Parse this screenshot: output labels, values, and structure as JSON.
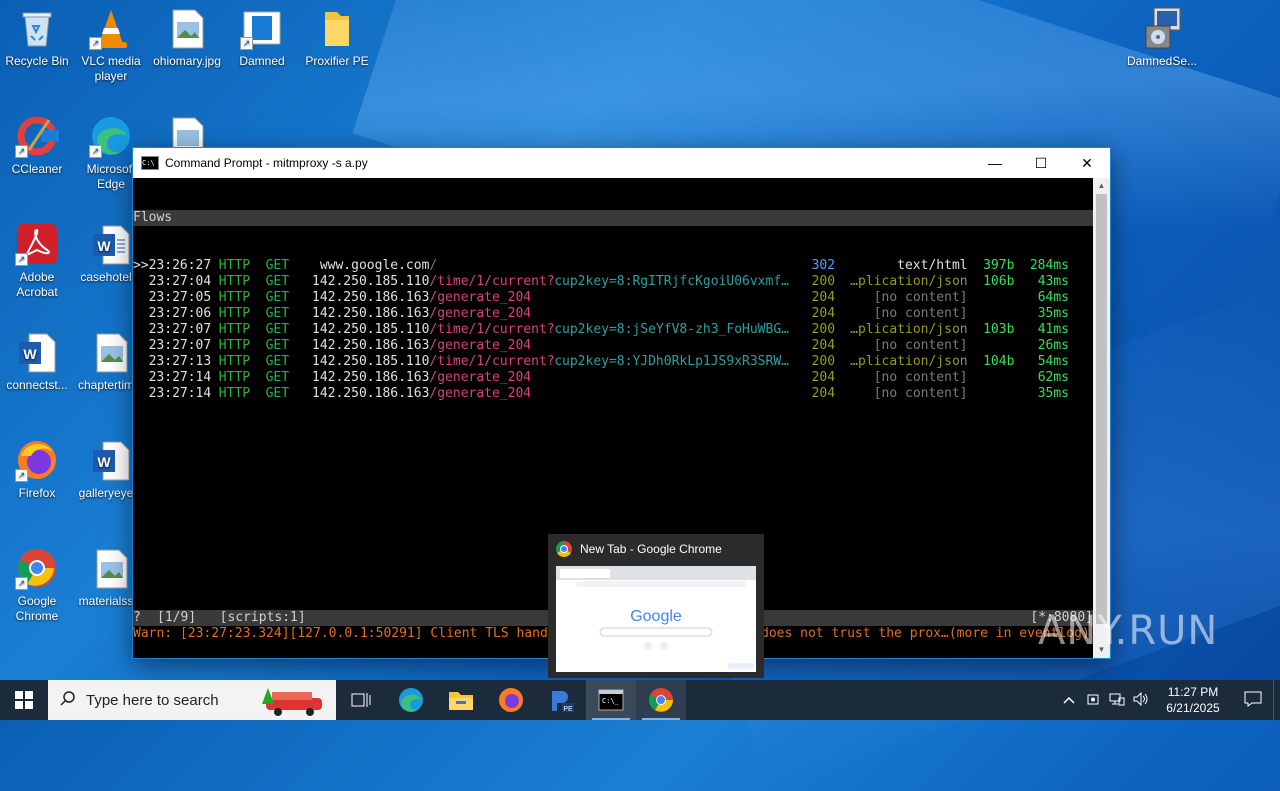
{
  "desktop": {
    "icons": [
      {
        "label": "Recycle Bin"
      },
      {
        "label": "VLC media player"
      },
      {
        "label": "ohiomary.jpg"
      },
      {
        "label": "Damned"
      },
      {
        "label": "Proxifier PE"
      },
      {
        "label": "DamnedSe..."
      },
      {
        "label": "CCleaner"
      },
      {
        "label": "Microsoft Edge"
      },
      {
        "label": "Adobe Acrobat"
      },
      {
        "label": "casehotel..."
      },
      {
        "label": "connectst..."
      },
      {
        "label": "chaptertim..."
      },
      {
        "label": "Firefox"
      },
      {
        "label": "galleryeye..."
      },
      {
        "label": "Google Chrome"
      },
      {
        "label": "materialss..."
      }
    ]
  },
  "window": {
    "title": "Command Prompt - mitmproxy  -s a.py",
    "header": "Flows",
    "flows": [
      {
        "marker": ">>",
        "time": "23:26:27",
        "proto": "HTTP",
        "method": "GET",
        "host": "www.google.com",
        "path": "/",
        "query": "",
        "code": "302",
        "type": "text/html",
        "size": "397b",
        "dur": "284ms"
      },
      {
        "marker": "",
        "time": "23:27:04",
        "proto": "HTTP",
        "method": "GET",
        "host": "142.250.185.110",
        "path": "/time/1/current?",
        "query": "cup2key=8:RgITRjfcKgoiU06vxmf…",
        "code": "200",
        "type": "…plication/json",
        "size": "106b",
        "dur": "43ms"
      },
      {
        "marker": "",
        "time": "23:27:05",
        "proto": "HTTP",
        "method": "GET",
        "host": "142.250.186.163",
        "path": "/generate_204",
        "query": "",
        "code": "204",
        "type": "[no content]",
        "size": "",
        "dur": "64ms"
      },
      {
        "marker": "",
        "time": "23:27:06",
        "proto": "HTTP",
        "method": "GET",
        "host": "142.250.186.163",
        "path": "/generate_204",
        "query": "",
        "code": "204",
        "type": "[no content]",
        "size": "",
        "dur": "35ms"
      },
      {
        "marker": "",
        "time": "23:27:07",
        "proto": "HTTP",
        "method": "GET",
        "host": "142.250.185.110",
        "path": "/time/1/current?",
        "query": "cup2key=8:jSeYfV8-zh3_FoHuWBG…",
        "code": "200",
        "type": "…plication/json",
        "size": "103b",
        "dur": "41ms"
      },
      {
        "marker": "",
        "time": "23:27:07",
        "proto": "HTTP",
        "method": "GET",
        "host": "142.250.186.163",
        "path": "/generate_204",
        "query": "",
        "code": "204",
        "type": "[no content]",
        "size": "",
        "dur": "26ms"
      },
      {
        "marker": "",
        "time": "23:27:13",
        "proto": "HTTP",
        "method": "GET",
        "host": "142.250.185.110",
        "path": "/time/1/current?",
        "query": "cup2key=8:YJDh0RkLp1JS9xR3SRW…",
        "code": "200",
        "type": "…plication/json",
        "size": "104b",
        "dur": "54ms"
      },
      {
        "marker": "",
        "time": "23:27:14",
        "proto": "HTTP",
        "method": "GET",
        "host": "142.250.186.163",
        "path": "/generate_204",
        "query": "",
        "code": "204",
        "type": "[no content]",
        "size": "",
        "dur": "62ms"
      },
      {
        "marker": "",
        "time": "23:27:14",
        "proto": "HTTP",
        "method": "GET",
        "host": "142.250.186.163",
        "path": "/generate_204",
        "query": "",
        "code": "204",
        "type": "[no content]",
        "size": "",
        "dur": "35ms"
      }
    ],
    "status_left": "[1/9]   [scripts:1]",
    "status_right": "[*:8080]",
    "warn_left": "Warn: [23:27:23.324][127.0.0.1:50291] Client TLS hand",
    "warn_right": "does not trust the prox…(more in eventlog)"
  },
  "thumbnail": {
    "title": "New Tab - Google Chrome",
    "logo": "Google"
  },
  "taskbar": {
    "search_placeholder": "Type here to search",
    "time": "11:27 PM",
    "date": "6/21/2025"
  },
  "watermark": "ANY.RUN"
}
